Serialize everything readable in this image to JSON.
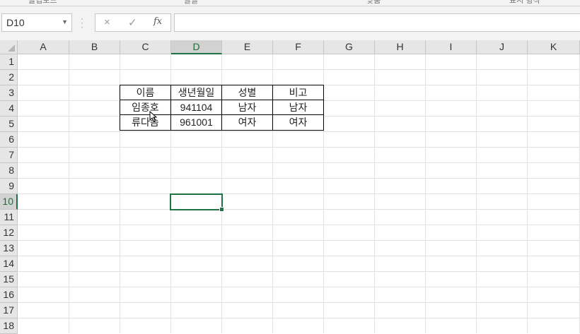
{
  "ribbon": {
    "fragments": [
      "클립보드",
      "글꼴",
      "맞춤",
      "표시 형식"
    ]
  },
  "formula_bar": {
    "name_box": "D10",
    "cancel_icon": "×",
    "enter_icon": "✓",
    "fx_label": "fx",
    "formula": ""
  },
  "columns": [
    "A",
    "B",
    "C",
    "D",
    "E",
    "F",
    "G",
    "H",
    "I",
    "J",
    "K"
  ],
  "selected_column": "D",
  "rows": [
    "1",
    "2",
    "3",
    "4",
    "5",
    "6",
    "7",
    "8",
    "9",
    "10",
    "11",
    "12",
    "13",
    "14",
    "15",
    "16",
    "17",
    "18"
  ],
  "selected_row": "10",
  "table": {
    "header": [
      "이름",
      "생년월일",
      "성별",
      "비고"
    ],
    "rows": [
      [
        "임종호",
        "941104",
        "남자",
        "남자"
      ],
      [
        "류다솜",
        "961001",
        "여자",
        "여자"
      ]
    ]
  },
  "active_cell": "D10",
  "colors": {
    "accent": "#217346",
    "header_bg": "#e6e6e6",
    "gridline": "#e1e1e1"
  }
}
